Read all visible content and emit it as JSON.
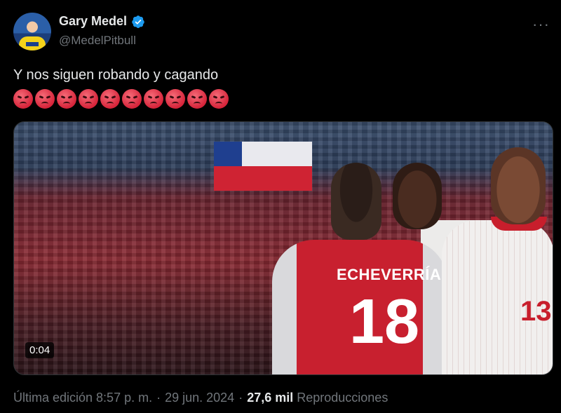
{
  "author": {
    "display_name": "Gary Medel",
    "handle": "@MedelPitbull",
    "verified_icon": "verified-badge-icon",
    "verified_color": "#1d9bf0"
  },
  "more_menu": {
    "label": "···",
    "icon": "more-options-icon"
  },
  "tweet": {
    "text": "Y nos siguen robando y cagando",
    "emoji_name": "angry-face-emoji",
    "emoji_count": 10
  },
  "media": {
    "duration": "0:04",
    "jersey_name": "ECHEVERRÍA",
    "jersey_number": "18",
    "opponent_number": "13"
  },
  "meta": {
    "edited_prefix": "Última edición 8:57 p. m.",
    "separator": "·",
    "date": "29 jun. 2024",
    "views_count": "27,6 mil",
    "views_label": "Reproducciones"
  },
  "colors": {
    "background": "#000000",
    "text_primary": "#e7e9ea",
    "text_secondary": "#71767b",
    "accent": "#1d9bf0"
  }
}
